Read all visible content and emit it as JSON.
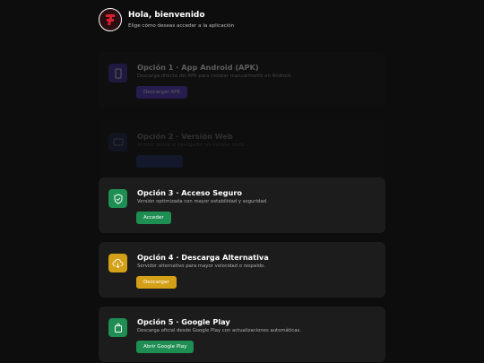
{
  "header": {
    "greeting": "Hola, bienvenido",
    "subtitle": "Elige cómo deseas acceder a la aplicación"
  },
  "options": [
    {
      "title": "Opción 1 · App Android (APK)",
      "desc": "Descarga directa del APK para instalar manualmente en Android.",
      "button": "Descargar APK",
      "icon": "phone-icon",
      "accent": "#5b3fd6"
    },
    {
      "title": "Opción 2 · Versión Web",
      "desc": "Accede desde el navegador sin instalar nada.",
      "button": "",
      "icon": "monitor-icon",
      "accent": "#3a5bd6"
    },
    {
      "title": "Opción 3 · Acceso Seguro",
      "desc": "Versión optimizada con mayor estabilidad y seguridad.",
      "button": "Acceder",
      "icon": "shield-check-icon",
      "accent": "#1e8e52"
    },
    {
      "title": "Opción 4 · Descarga Alternativa",
      "desc": "Servidor alternativo para mayor velocidad o respaldo.",
      "button": "Descargar",
      "icon": "cloud-download-icon",
      "accent": "#d4a017"
    },
    {
      "title": "Opción 5 · Google Play",
      "desc": "Descarga oficial desde Google Play con actualizaciones automáticas.",
      "button": "Abrir Google Play",
      "icon": "shopping-bag-icon",
      "accent": "#1e8e52"
    }
  ]
}
